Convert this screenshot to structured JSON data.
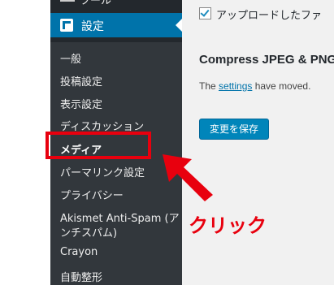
{
  "sidebar": {
    "top_item_label": "ツール",
    "active_label": "設定",
    "submenu": [
      {
        "label": "一般"
      },
      {
        "label": "投稿設定"
      },
      {
        "label": "表示設定"
      },
      {
        "label": "ディスカッション"
      },
      {
        "label": "メディア"
      },
      {
        "label": "パーマリンク設定"
      },
      {
        "label": "プライバシー"
      },
      {
        "label": "Akismet Anti-Spam (ア"
      },
      {
        "label": "ンチスパム)"
      },
      {
        "label": "Crayon"
      },
      {
        "label": "自動整形"
      }
    ]
  },
  "content": {
    "checkbox_label": "アップロードしたファ",
    "section_title": "Compress JPEG & PNG",
    "moved_prefix": "The ",
    "moved_link": "settings",
    "moved_suffix": " have moved.",
    "save_button": "変更を保存"
  },
  "annotation": {
    "click_text": "クリック",
    "color": "#e8000e"
  },
  "colors": {
    "sidebar_bg": "#23282d",
    "submenu_bg": "#32373c",
    "active_bg": "#0073aa",
    "button_bg": "#0085ba"
  }
}
